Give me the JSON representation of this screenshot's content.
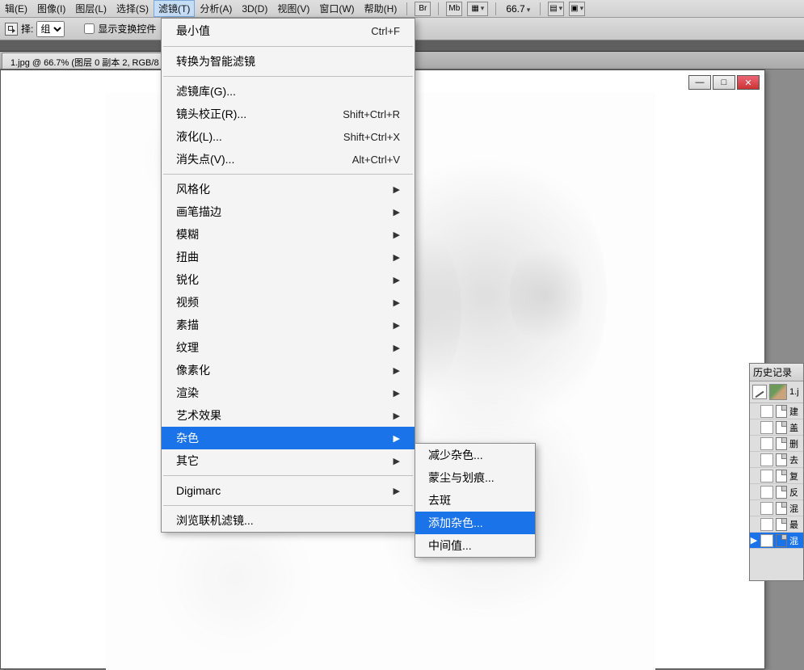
{
  "menubar": {
    "items": [
      {
        "label": "辑(E)"
      },
      {
        "label": "图像(I)"
      },
      {
        "label": "图层(L)"
      },
      {
        "label": "选择(S)"
      },
      {
        "label": "滤镜(T)"
      },
      {
        "label": "分析(A)"
      },
      {
        "label": "3D(D)"
      },
      {
        "label": "视图(V)"
      },
      {
        "label": "窗口(W)"
      },
      {
        "label": "帮助(H)"
      }
    ],
    "tool_br": "Br",
    "tool_mb": "Mb",
    "zoom": "66.7"
  },
  "toolbar2": {
    "label": "择:",
    "select_value": "组",
    "checkbox_label": "显示变换控件"
  },
  "doctab": {
    "title": "1.jpg @ 66.7% (图层 0 副本 2, RGB/8"
  },
  "window_buttons": {
    "min": "—",
    "max": "□",
    "close": "✕"
  },
  "filter_menu": {
    "last": {
      "label": "最小值",
      "shortcut": "Ctrl+F"
    },
    "smart": "转换为智能滤镜",
    "gallery": "滤镜库(G)...",
    "lens": {
      "label": "镜头校正(R)...",
      "shortcut": "Shift+Ctrl+R"
    },
    "liquify": {
      "label": "液化(L)...",
      "shortcut": "Shift+Ctrl+X"
    },
    "vanish": {
      "label": "消失点(V)...",
      "shortcut": "Alt+Ctrl+V"
    },
    "groups": [
      "风格化",
      "画笔描边",
      "模糊",
      "扭曲",
      "锐化",
      "视频",
      "素描",
      "纹理",
      "像素化",
      "渲染",
      "艺术效果",
      "杂色",
      "其它"
    ],
    "digimarc": "Digimarc",
    "browse": "浏览联机滤镜..."
  },
  "noise_submenu": {
    "items": [
      "减少杂色...",
      "蒙尘与划痕...",
      "去斑",
      "添加杂色...",
      "中间值..."
    ]
  },
  "history": {
    "title": "历史记录",
    "thumb_label": "1.j",
    "rows": [
      "建",
      "盖",
      "删",
      "去",
      "复",
      "反",
      "混",
      "最",
      "混"
    ]
  }
}
